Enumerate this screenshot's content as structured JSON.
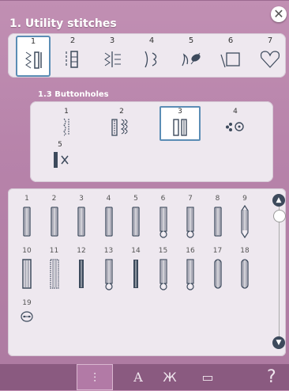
{
  "window": {
    "close_symbol": "✕"
  },
  "header": {
    "title": "1. Utility stitches"
  },
  "categories": [
    {
      "num": "1",
      "icon": "straight-stitch-icon"
    },
    {
      "num": "2",
      "icon": "zigzag-stitch-icon"
    },
    {
      "num": "3",
      "icon": "overlock-stitch-icon"
    },
    {
      "num": "4",
      "icon": "blind-hem-icon"
    },
    {
      "num": "5",
      "icon": "decorative-stitch-icon"
    },
    {
      "num": "6",
      "icon": "frame-stitch-icon"
    },
    {
      "num": "7",
      "icon": "heart-icon"
    }
  ],
  "subcategory": {
    "title": "1.3 Buttonholes",
    "items": [
      {
        "num": "1"
      },
      {
        "num": "2"
      },
      {
        "num": "3"
      },
      {
        "num": "4"
      },
      {
        "num": "5"
      }
    ]
  },
  "stitches": [
    "1",
    "2",
    "3",
    "4",
    "5",
    "6",
    "7",
    "8",
    "9",
    "10",
    "11",
    "12",
    "13",
    "14",
    "15",
    "16",
    "17",
    "18",
    "19"
  ],
  "scroll": {
    "up": "▲",
    "down": "▼"
  },
  "bottombar": {
    "tabs": [
      {
        "icon": "stitch-menu-icon",
        "glyph": "⫶"
      },
      {
        "icon": "font-icon",
        "glyph": "A"
      },
      {
        "icon": "butterfly-icon",
        "glyph": "Ж"
      },
      {
        "icon": "folder-icon",
        "glyph": "▭"
      }
    ],
    "help": "?"
  },
  "colors": {
    "accent": "#5b8db5",
    "panel": "#eee8ef",
    "bg": "#b783aa",
    "bar": "#8a5a80",
    "stitch": "#3d4a5c"
  }
}
